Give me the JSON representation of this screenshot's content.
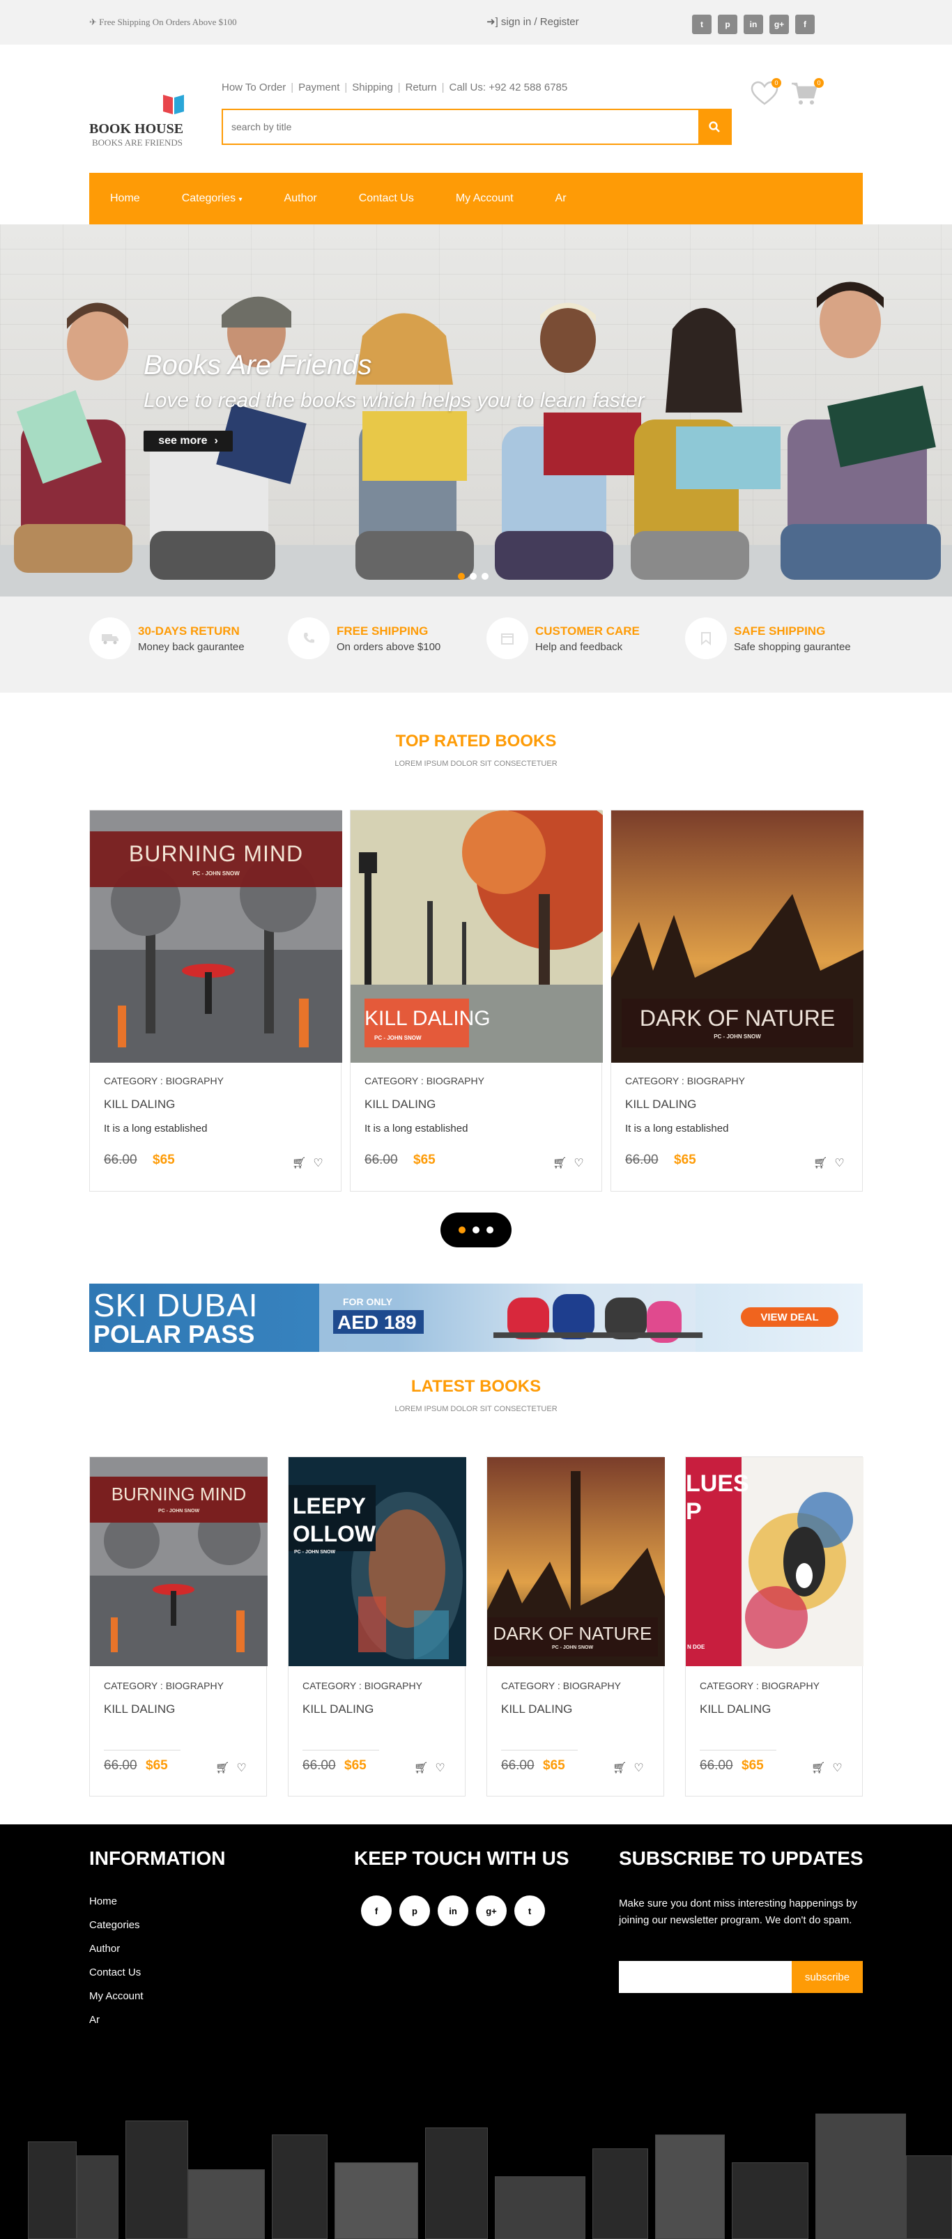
{
  "topbar": {
    "shipping": "Free Shipping On Orders Above $100",
    "sign": "sign in / Register",
    "social": [
      "t",
      "p",
      "in",
      "g+",
      "f"
    ]
  },
  "logo": {
    "title": "BOOK HOUSE",
    "tagline": "BOOKS ARE FRIENDS"
  },
  "header": {
    "links": [
      "How To Order",
      "Payment",
      "Shipping",
      "Return",
      "Call Us: +92 42 588 6785"
    ],
    "search_placeholder": "search by title",
    "wishlist_count": "0",
    "cart_count": "0"
  },
  "nav": [
    "Home",
    "Categories",
    "Author",
    "Contact Us",
    "My Account",
    "Ar"
  ],
  "hero": {
    "title": "Books Are Friends",
    "subtitle": "Love to read the books which helps you to learn faster",
    "button": "see more"
  },
  "features": [
    {
      "title": "30-DAYS RETURN",
      "sub": "Money back gaurantee"
    },
    {
      "title": "FREE SHIPPING",
      "sub": "On orders above $100"
    },
    {
      "title": "CUSTOMER CARE",
      "sub": "Help and feedback"
    },
    {
      "title": "SAFE SHIPPING",
      "sub": "Safe shopping gaurantee"
    }
  ],
  "top_rated": {
    "title": "TOP RATED BOOKS",
    "subtitle": "LOREM IPSUM DOLOR SIT CONSECTETUER",
    "books": [
      {
        "cover_text": "BURNING MIND",
        "cover_author": "PC - JOHN SNOW",
        "category": "CATEGORY : BIOGRAPHY",
        "title": "KILL DALING",
        "desc": "It is a long established",
        "old_price": "66.00",
        "price": "$65"
      },
      {
        "cover_text": "KILL DALING",
        "cover_author": "PC - JOHN SNOW",
        "category": "CATEGORY : BIOGRAPHY",
        "title": "KILL DALING",
        "desc": "It is a long established",
        "old_price": "66.00",
        "price": "$65"
      },
      {
        "cover_text": "DARK OF NATURE",
        "cover_author": "PC - JOHN SNOW",
        "category": "CATEGORY : BIOGRAPHY",
        "title": "KILL DALING",
        "desc": "It is a long established",
        "old_price": "66.00",
        "price": "$65"
      }
    ]
  },
  "banner": {
    "line1": "SKI DUBAI",
    "line2": "POLAR PASS",
    "for_only": "FOR ONLY",
    "price": "AED 189",
    "cta": "VIEW DEAL"
  },
  "latest": {
    "title": "LATEST BOOKS",
    "subtitle": "LOREM IPSUM DOLOR SIT CONSECTETUER",
    "books": [
      {
        "cover_text": "BURNING MIND",
        "cover_author": "PC - JOHN SNOW",
        "category": "CATEGORY : BIOGRAPHY",
        "title": "KILL DALING",
        "old_price": "66.00",
        "price": "$65"
      },
      {
        "cover_text": "LEEPY\nOLLOW",
        "cover_author": "PC - JOHN SNOW",
        "category": "CATEGORY : BIOGRAPHY",
        "title": "KILL DALING",
        "old_price": "66.00",
        "price": "$65"
      },
      {
        "cover_text": "DARK OF NATURE",
        "cover_author": "PC - JOHN SNOW",
        "category": "CATEGORY : BIOGRAPHY",
        "title": "KILL DALING",
        "old_price": "66.00",
        "price": "$65"
      },
      {
        "cover_text": "LUES\nP",
        "cover_author": "N DOE",
        "category": "CATEGORY : BIOGRAPHY",
        "title": "KILL DALING",
        "old_price": "66.00",
        "price": "$65"
      }
    ]
  },
  "footer": {
    "info_title": "INFORMATION",
    "info_links": [
      "Home",
      "Categories",
      "Author",
      "Contact Us",
      "My Account",
      "Ar"
    ],
    "touch_title": "KEEP TOUCH WITH US",
    "touch_social": [
      "f",
      "p",
      "in",
      "g+",
      "t"
    ],
    "subscribe_title": "SUBSCRIBE TO UPDATES",
    "subscribe_text": "Make sure you dont miss interesting happenings by joining our newsletter program. We don't do spam.",
    "subscribe_button": "subscribe"
  },
  "colors": {
    "accent": "#fe9b06",
    "footer_bg": "#000000",
    "topbar_bg": "#f2f2f2"
  }
}
